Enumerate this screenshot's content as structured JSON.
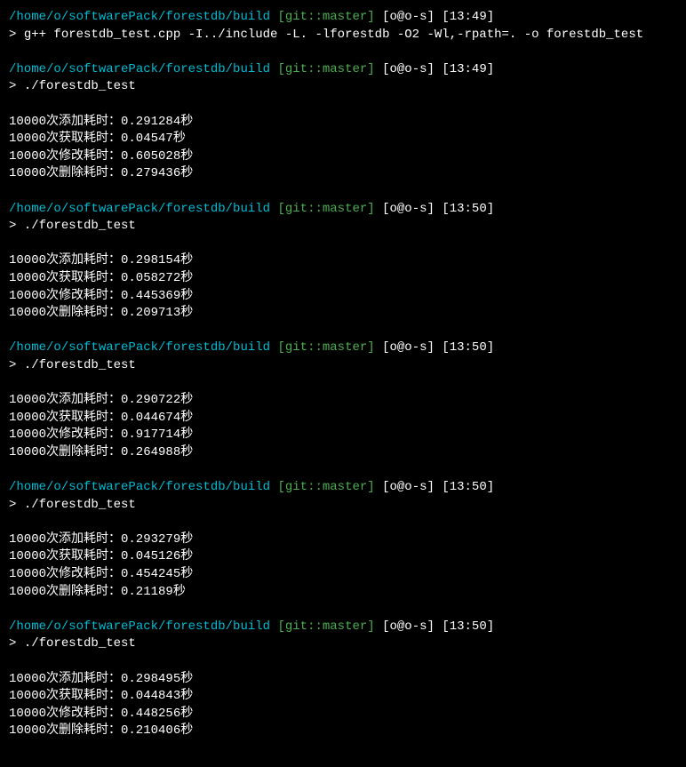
{
  "blocks": [
    {
      "path": "/home/o/softwarePack/forestdb/build",
      "git": "[git::master]",
      "userhost": "[o@o-s]",
      "time": "[13:49]",
      "cmd": "g++ forestdb_test.cpp -I../include -L. -lforestdb -O2 -Wl,-rpath=. -o forestdb_test",
      "output": []
    },
    {
      "path": "/home/o/softwarePack/forestdb/build",
      "git": "[git::master]",
      "userhost": "[o@o-s]",
      "time": "[13:49]",
      "cmd": "./forestdb_test",
      "output": [
        "10000次添加耗时：0.291284秒",
        "10000次获取耗时：0.04547秒",
        "10000次修改耗时：0.605028秒",
        "10000次删除耗时：0.279436秒"
      ]
    },
    {
      "path": "/home/o/softwarePack/forestdb/build",
      "git": "[git::master]",
      "userhost": "[o@o-s]",
      "time": "[13:50]",
      "cmd": "./forestdb_test",
      "output": [
        "10000次添加耗时：0.298154秒",
        "10000次获取耗时：0.058272秒",
        "10000次修改耗时：0.445369秒",
        "10000次删除耗时：0.209713秒"
      ]
    },
    {
      "path": "/home/o/softwarePack/forestdb/build",
      "git": "[git::master]",
      "userhost": "[o@o-s]",
      "time": "[13:50]",
      "cmd": "./forestdb_test",
      "output": [
        "10000次添加耗时：0.290722秒",
        "10000次获取耗时：0.044674秒",
        "10000次修改耗时：0.917714秒",
        "10000次删除耗时：0.264988秒"
      ]
    },
    {
      "path": "/home/o/softwarePack/forestdb/build",
      "git": "[git::master]",
      "userhost": "[o@o-s]",
      "time": "[13:50]",
      "cmd": "./forestdb_test",
      "output": [
        "10000次添加耗时：0.293279秒",
        "10000次获取耗时：0.045126秒",
        "10000次修改耗时：0.454245秒",
        "10000次删除耗时：0.21189秒"
      ]
    },
    {
      "path": "/home/o/softwarePack/forestdb/build",
      "git": "[git::master]",
      "userhost": "[o@o-s]",
      "time": "[13:50]",
      "cmd": "./forestdb_test",
      "output": [
        "10000次添加耗时：0.298495秒",
        "10000次获取耗时：0.044843秒",
        "10000次修改耗时：0.448256秒",
        "10000次删除耗时：0.210406秒"
      ]
    }
  ],
  "prompt_symbol": ">"
}
